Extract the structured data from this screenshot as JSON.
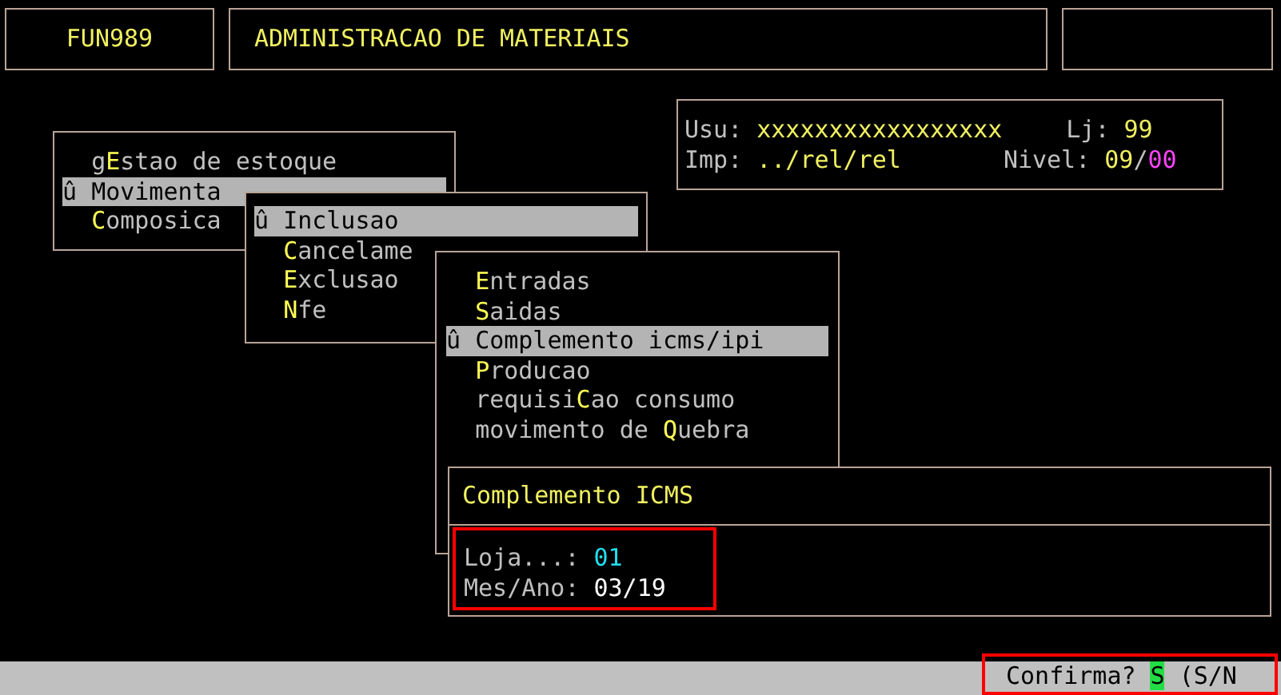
{
  "header": {
    "code": "FUN989",
    "title": "ADMINISTRACAO DE MATERIAIS"
  },
  "info": {
    "user_label": "Usu:",
    "user": "xxxxxxxxxxxxxxxxx",
    "store_label": "Lj:",
    "store": "99",
    "printer_label": "Imp:",
    "printer": "../rel/rel",
    "level_label": "Nivel:",
    "level_main": "09",
    "level_separator": "/",
    "level_sub": "00"
  },
  "menus": [
    {
      "cursor": "û",
      "items": [
        {
          "before": "g",
          "hotkey": "E",
          "after": "stao de estoque",
          "selected": false
        },
        {
          "before": "Movimenta",
          "selected": true
        },
        {
          "hotkey": "C",
          "after": "omposica",
          "selected": false
        }
      ]
    },
    {
      "cursor": "û",
      "items": [
        {
          "before": "Inclusao",
          "selected": true
        },
        {
          "hotkey": "C",
          "after": "ancelame",
          "selected": false
        },
        {
          "hotkey": "E",
          "after": "xclusao",
          "selected": false
        },
        {
          "hotkey": "N",
          "after": "fe",
          "selected": false
        }
      ]
    },
    {
      "cursor": "û",
      "items": [
        {
          "hotkey": "E",
          "after": "ntradas",
          "selected": false
        },
        {
          "hotkey": "S",
          "after": "aidas",
          "selected": false
        },
        {
          "before": "Complemento icms/ipi",
          "selected": true
        },
        {
          "hotkey": "P",
          "after": "roducao",
          "selected": false
        },
        {
          "before": "requisi",
          "hotkey": "C",
          "after": "ao consumo",
          "selected": false
        },
        {
          "before": "movimento de ",
          "hotkey": "Q",
          "after": "uebra",
          "selected": false
        }
      ]
    }
  ],
  "dialog": {
    "title": "Complemento ICMS",
    "fields": [
      {
        "label": "Loja...:",
        "value": "01",
        "kind": "accepted"
      },
      {
        "label": "Mes/Ano:",
        "value": "03/19",
        "kind": "current"
      }
    ]
  },
  "status_bar": {
    "prompt": "Confirma?",
    "answer": "S",
    "options": "(S/N"
  }
}
